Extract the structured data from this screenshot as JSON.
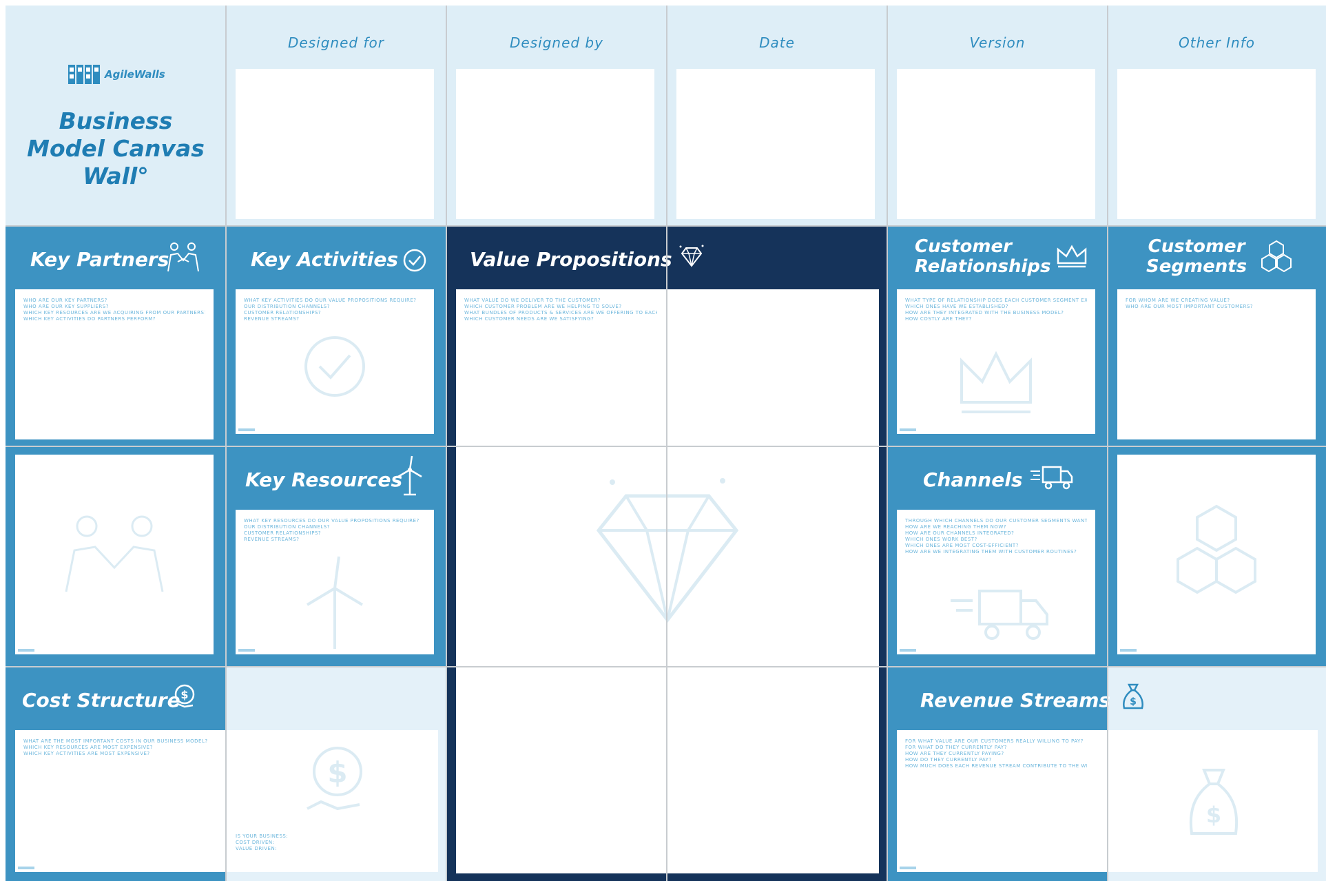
{
  "brand": {
    "logo_text": "AgileWalls",
    "title_line1": "Business",
    "title_line2": "Model Canvas",
    "title_line3": "Wall°"
  },
  "header_fields": [
    {
      "label": "Designed for"
    },
    {
      "label": "Designed by"
    },
    {
      "label": "Date"
    },
    {
      "label": "Version"
    },
    {
      "label": "Other Info"
    }
  ],
  "blocks": {
    "key_partners": {
      "title": "Key Partners",
      "questions": [
        "Who are our key partners?",
        "Who are our key suppliers?",
        "Which key resources are we acquiring from our partners?",
        "Which key activities do partners perform?"
      ]
    },
    "key_activities": {
      "title": "Key Activities",
      "questions": [
        "What key activities do our value propositions require?",
        "Our distribution channels?",
        "Customer relationships?",
        "Revenue streams?"
      ]
    },
    "value_propositions": {
      "title": "Value Propositions",
      "questions": [
        "What value do we deliver to the customer?",
        "Which customer problem are we helping to solve?",
        "What bundles of products & services are we offering to each customer segment?",
        "Which customer needs are we satisfying?"
      ]
    },
    "customer_relationships": {
      "title_line1": "Customer",
      "title_line2": "Relationships",
      "questions": [
        "What type of relationship does each customer segment expect?",
        "Which ones have we established?",
        "How are they integrated with the business model?",
        "How costly are they?"
      ]
    },
    "customer_segments": {
      "title_line1": "Customer",
      "title_line2": "Segments",
      "questions": [
        "For whom are we creating value?",
        "Who are our most important customers?"
      ]
    },
    "key_resources": {
      "title": "Key Resources",
      "questions": [
        "What key resources do our value propositions require?",
        "Our distribution channels?",
        "Customer relationships?",
        "Revenue streams?"
      ]
    },
    "channels": {
      "title": "Channels",
      "questions": [
        "Through which channels do our customer segments want to be reached?",
        "How are we reaching them now?",
        "How are our channels integrated?",
        "Which ones work best?",
        "Which ones are most cost-efficient?",
        "How are we integrating them with customer routines?"
      ]
    },
    "cost_structure": {
      "title": "Cost Structure",
      "questions": [
        "What are the most important costs in our business model?",
        "Which key resources are most expensive?",
        "Which key activities are most expensive?"
      ],
      "footer_questions": [
        "Is your business:",
        "Cost driven:",
        "Value driven:"
      ]
    },
    "revenue_streams": {
      "title": "Revenue Streams",
      "questions": [
        "For what value are our customers really willing to pay?",
        "For what do they currently pay?",
        "How are they currently paying?",
        "How do they currently pay?",
        "How much does each revenue stream contribute to the whole?"
      ]
    }
  },
  "colors": {
    "light_header": "#deeef7",
    "mid_blue": "#3d93c2",
    "dark_blue": "#15335a",
    "accent_text": "#2e8cbf"
  }
}
